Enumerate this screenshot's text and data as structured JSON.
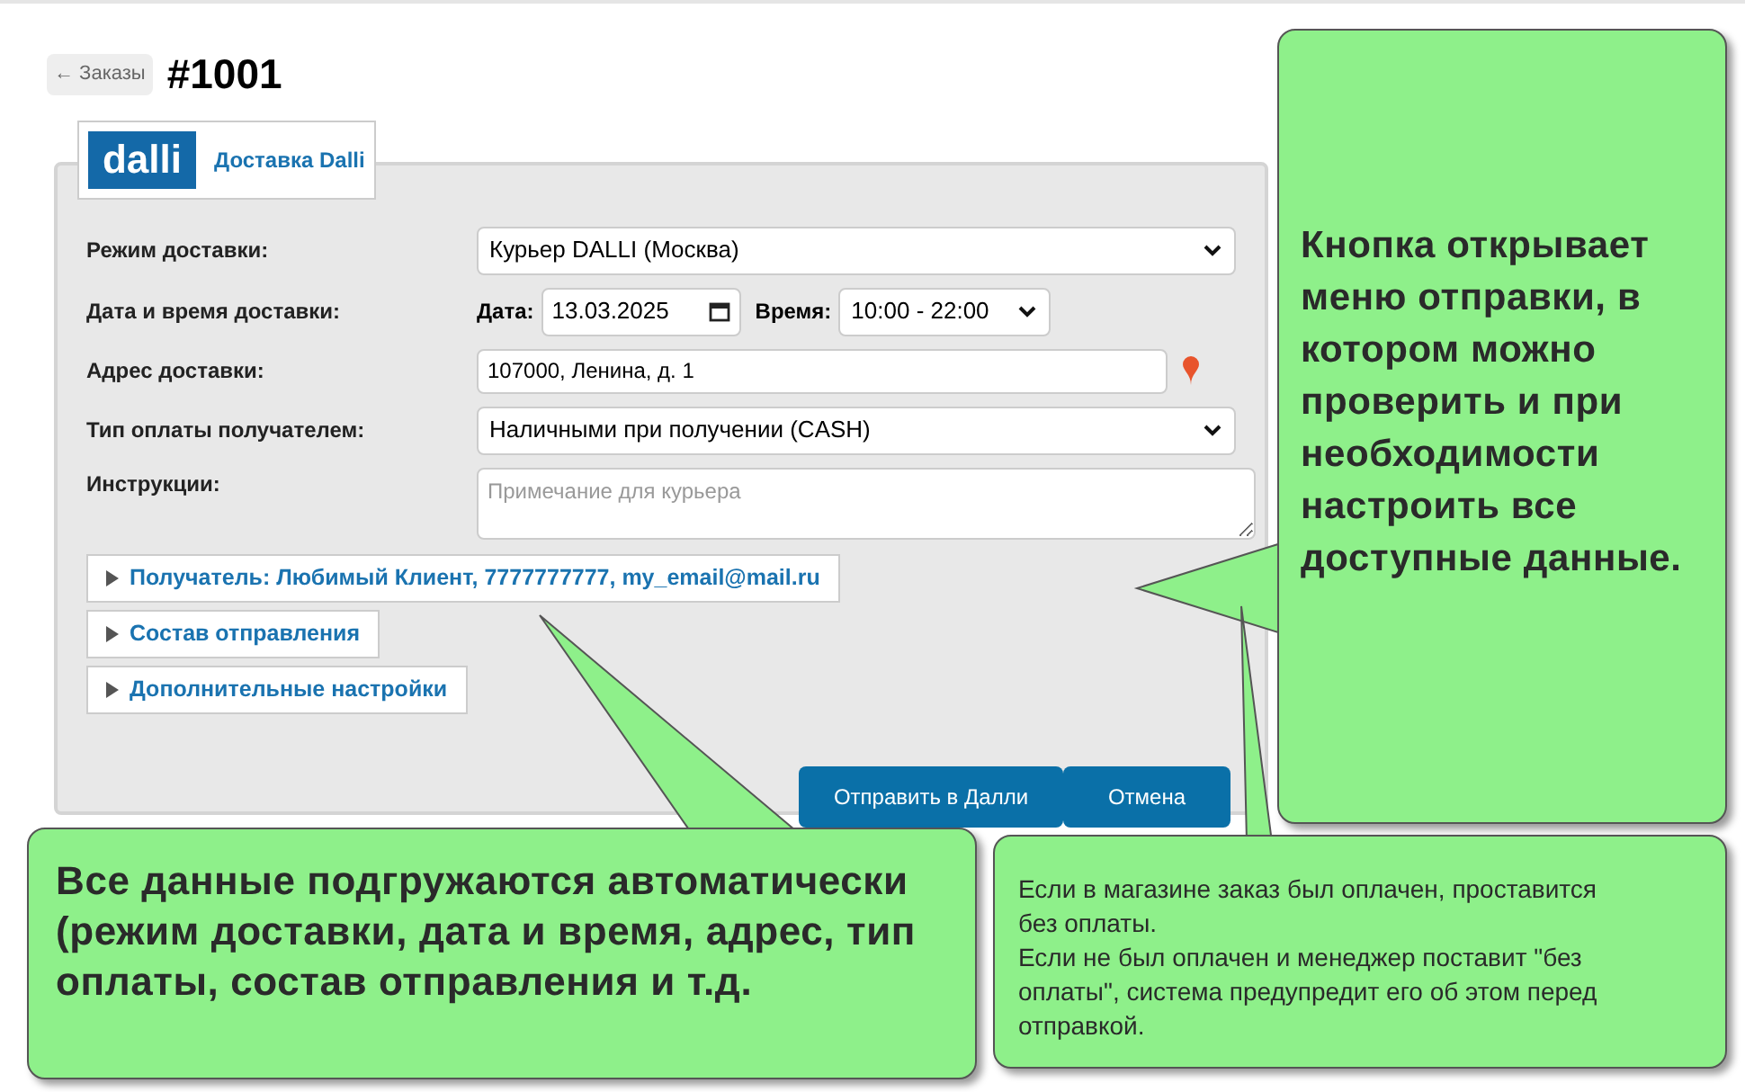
{
  "back_button": "← Заказы",
  "order_title": "#1001",
  "tab": {
    "logo": "dalli",
    "title": "Доставка Dalli"
  },
  "form": {
    "delivery_mode": {
      "label": "Режим доставки:",
      "value": "Курьер DALLI (Москва)"
    },
    "datetime": {
      "label": "Дата и время доставки:",
      "date_label": "Дата:",
      "date": "13.03.2025",
      "time_label": "Время:",
      "time": "10:00 - 22:00"
    },
    "address": {
      "label": "Адрес доставки:",
      "value": "107000, Ленина, д. 1"
    },
    "payment": {
      "label": "Тип оплаты получателем:",
      "value": "Наличными при получении (CASH)"
    },
    "instructions": {
      "label": "Инструкции:",
      "placeholder": "Примечание для курьера"
    }
  },
  "sections": [
    {
      "title": "Получатель: Любимый Клиент, 7777777777, my_email@mail.ru",
      "expanded": false
    },
    {
      "title": "Состав отправления",
      "expanded": false
    },
    {
      "title": "Дополнительные настройки",
      "expanded": false
    }
  ],
  "buttons": [
    {
      "label": "Отправить в Далли",
      "kind": "primary"
    },
    {
      "label": "Отмена",
      "kind": "primary"
    }
  ],
  "callouts": [
    {
      "text": "Кнопка открывает меню отправки, в котором можно проверить и при необходимости настроить все доступные данные.",
      "kind": "large"
    },
    {
      "text": "Все данные подгружаются автоматически (режим доставки, дата и время, адрес, тип оплаты, состав отправления и т.д.",
      "kind": "large"
    },
    {
      "text": "Если в магазине заказ был оплачен, проставится без оплаты.\nЕсли не был оплачен и менеджер поставит \"без оплаты\", система предупредит его об этом перед отправкой.",
      "kind": "small"
    }
  ]
}
